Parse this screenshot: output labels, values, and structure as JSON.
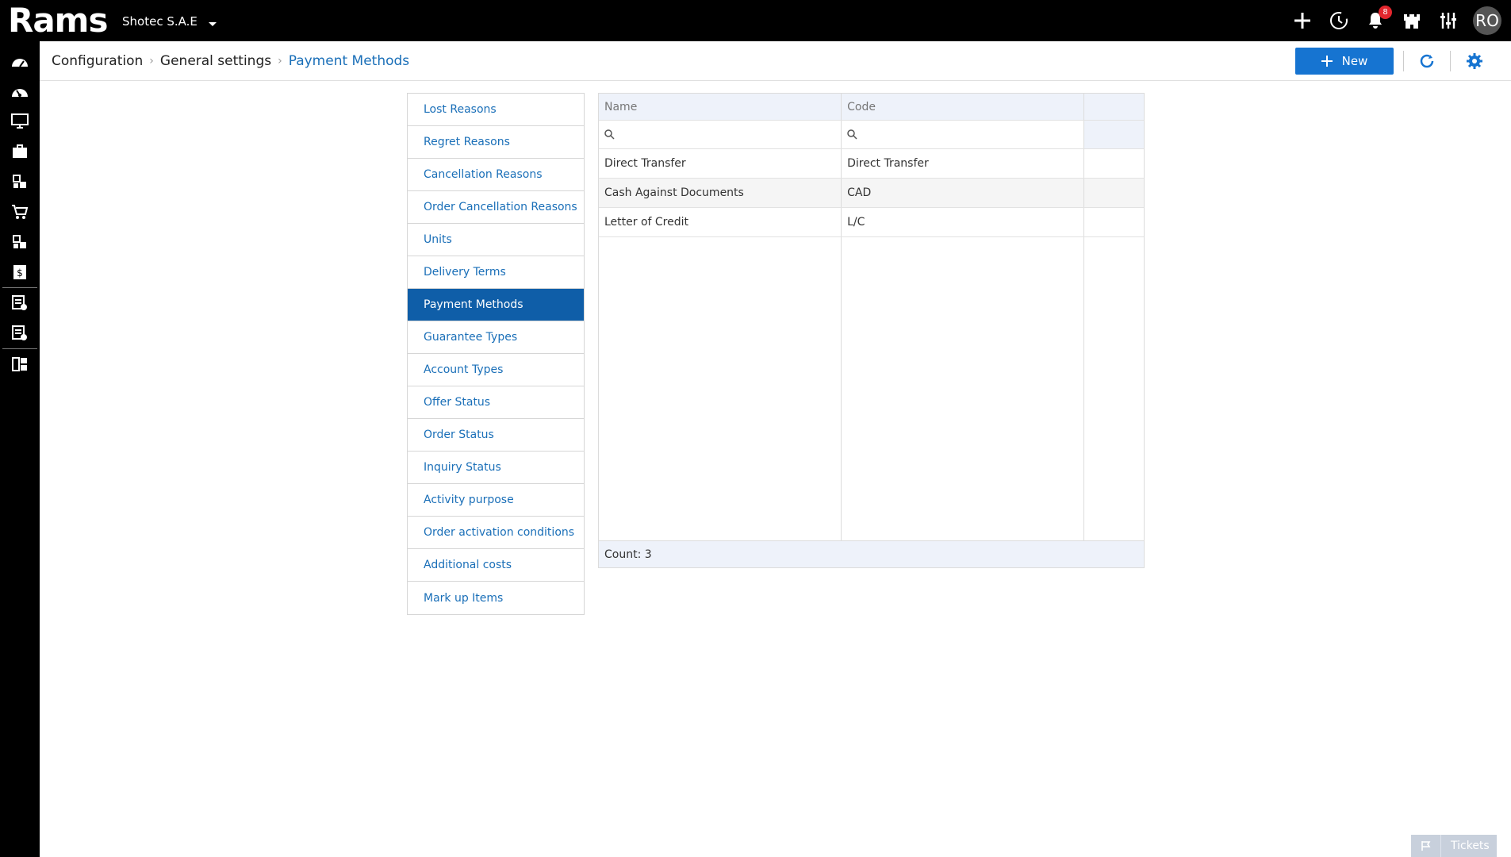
{
  "app": {
    "logo_text": "Rams",
    "company": "Shotec S.A.E",
    "notifications_count": "8",
    "user_initials": "RO"
  },
  "breadcrumb": [
    "Configuration",
    "General settings",
    "Payment Methods"
  ],
  "header": {
    "new_label": "New"
  },
  "leftnav": {
    "items": [
      "Lost Reasons",
      "Regret Reasons",
      "Cancellation Reasons",
      "Order Cancellation Reasons",
      "Units",
      "Delivery Terms",
      "Payment Methods",
      "Guarantee Types",
      "Account Types",
      "Offer Status",
      "Order Status",
      "Inquiry Status",
      "Activity purpose",
      "Order activation conditions",
      "Additional costs",
      "Mark up Items"
    ],
    "selected": "Payment Methods"
  },
  "grid": {
    "columns": [
      "Name",
      "Code"
    ],
    "rows": [
      {
        "name": "Direct Transfer",
        "code": "Direct Transfer"
      },
      {
        "name": "Cash Against Documents",
        "code": "CAD"
      },
      {
        "name": "Letter of Credit",
        "code": "L/C"
      }
    ],
    "count_label": "Count: 3"
  },
  "footer": {
    "tickets_label": "Tickets"
  },
  "colors": {
    "accent": "#1674d1",
    "selected_nav": "#0f5ea8",
    "link": "#1a6fb8",
    "topbar": "#000000",
    "badge": "#e3262d"
  }
}
